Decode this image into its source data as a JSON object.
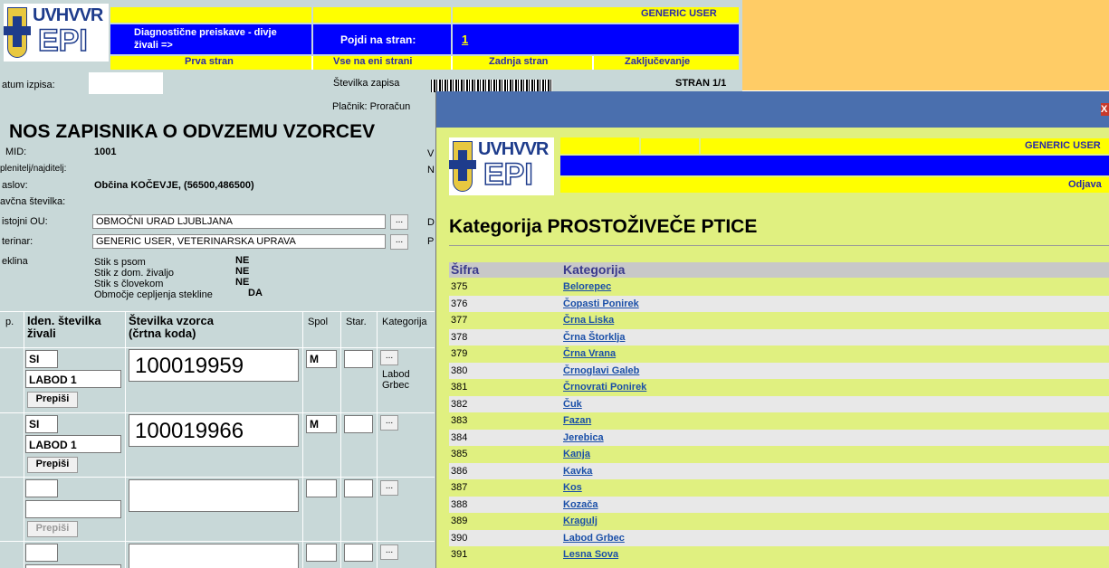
{
  "header": {
    "title_line1": "Diagnostične preiskave - divje",
    "title_line2": "živali  =>",
    "goto_label": "Pojdi na stran:",
    "goto_page": "1",
    "user": "GENERIC USER"
  },
  "nav": {
    "first": "Prva stran",
    "all": "Vse na eni strani",
    "last": "Zadnja stran",
    "finish": "Zaključevanje"
  },
  "logo": {
    "top": "UVHVVR",
    "bottom": "EPI"
  },
  "meta": {
    "date_label": "atum izpisa:",
    "record_label": "Številka zapisa",
    "payer": "Plačnik: Proračun",
    "page": "STRAN 1/1"
  },
  "doc_title": "NOS ZAPISNIKA O ODVZEMU VZORCEV",
  "form": {
    "mid_label": "MID:",
    "mid_value": "1001",
    "finder_label": "plenitelj/najditelj:",
    "address_label": "aslov:",
    "address_value": "Občina KOČEVJE, (56500,486500)",
    "tax_label": "avčna številka:",
    "ou_label": "istojni OU:",
    "ou_value": "OBMOČNI URAD  LJUBLJANA",
    "vet_label": "terinar:",
    "vet_value": "GENERIC USER, VETERINARSKA UPRAVA",
    "rabies_label": "eklina",
    "rabies_items": [
      {
        "label": "Stik s psom",
        "value": "NE"
      },
      {
        "label": "Stik z dom. živaljo",
        "value": "NE"
      },
      {
        "label": "Stik s človekom",
        "value": "NE"
      },
      {
        "label": "Območje cepljenja stekline",
        "value": "DA"
      }
    ],
    "side_v": "V",
    "side_n": "N",
    "side_d": "D",
    "side_p": "P",
    "dots": "..."
  },
  "table": {
    "col_zp": "p.",
    "col_id_1": "Iden. številka",
    "col_id_2": "živali",
    "col_sample_1": "Številka vzorca",
    "col_sample_2": "(črtna koda)",
    "col_sex": "Spol",
    "col_age": "Star.",
    "col_cat": "Kategorija",
    "rows": [
      {
        "country": "SI",
        "animal": "LABOD 1",
        "copy": "Prepiši",
        "sample": "100019959",
        "sex": "M",
        "category1": "Labod",
        "category2": "Grbec"
      },
      {
        "country": "SI",
        "animal": "LABOD 1",
        "copy": "Prepiši",
        "sample": "100019966",
        "sex": "M",
        "category1": "",
        "category2": ""
      },
      {
        "country": "",
        "animal": "",
        "copy": "Prepiši",
        "sample": "",
        "sex": "",
        "category1": "",
        "category2": ""
      }
    ]
  },
  "popup": {
    "user": "GENERIC USER",
    "logout": "Odjava",
    "close": "X",
    "title": "Kategorija PROSTOŽIVEČE PTICE",
    "col_code": "Šifra",
    "col_name": "Kategorija",
    "items": [
      {
        "code": "375",
        "name": "Belorepec"
      },
      {
        "code": "376",
        "name": "Čopasti Ponirek"
      },
      {
        "code": "377",
        "name": "Črna Liska"
      },
      {
        "code": "378",
        "name": "Črna Štorklja"
      },
      {
        "code": "379",
        "name": "Črna Vrana"
      },
      {
        "code": "380",
        "name": "Črnoglavi Galeb"
      },
      {
        "code": "381",
        "name": "Črnovrati Ponirek"
      },
      {
        "code": "382",
        "name": "Čuk"
      },
      {
        "code": "383",
        "name": "Fazan"
      },
      {
        "code": "384",
        "name": "Jerebica"
      },
      {
        "code": "385",
        "name": "Kanja"
      },
      {
        "code": "386",
        "name": "Kavka"
      },
      {
        "code": "387",
        "name": "Kos"
      },
      {
        "code": "388",
        "name": "Kozača"
      },
      {
        "code": "389",
        "name": "Kragulj"
      },
      {
        "code": "390",
        "name": "Labod Grbec"
      },
      {
        "code": "391",
        "name": "Lesna Sova"
      }
    ]
  }
}
